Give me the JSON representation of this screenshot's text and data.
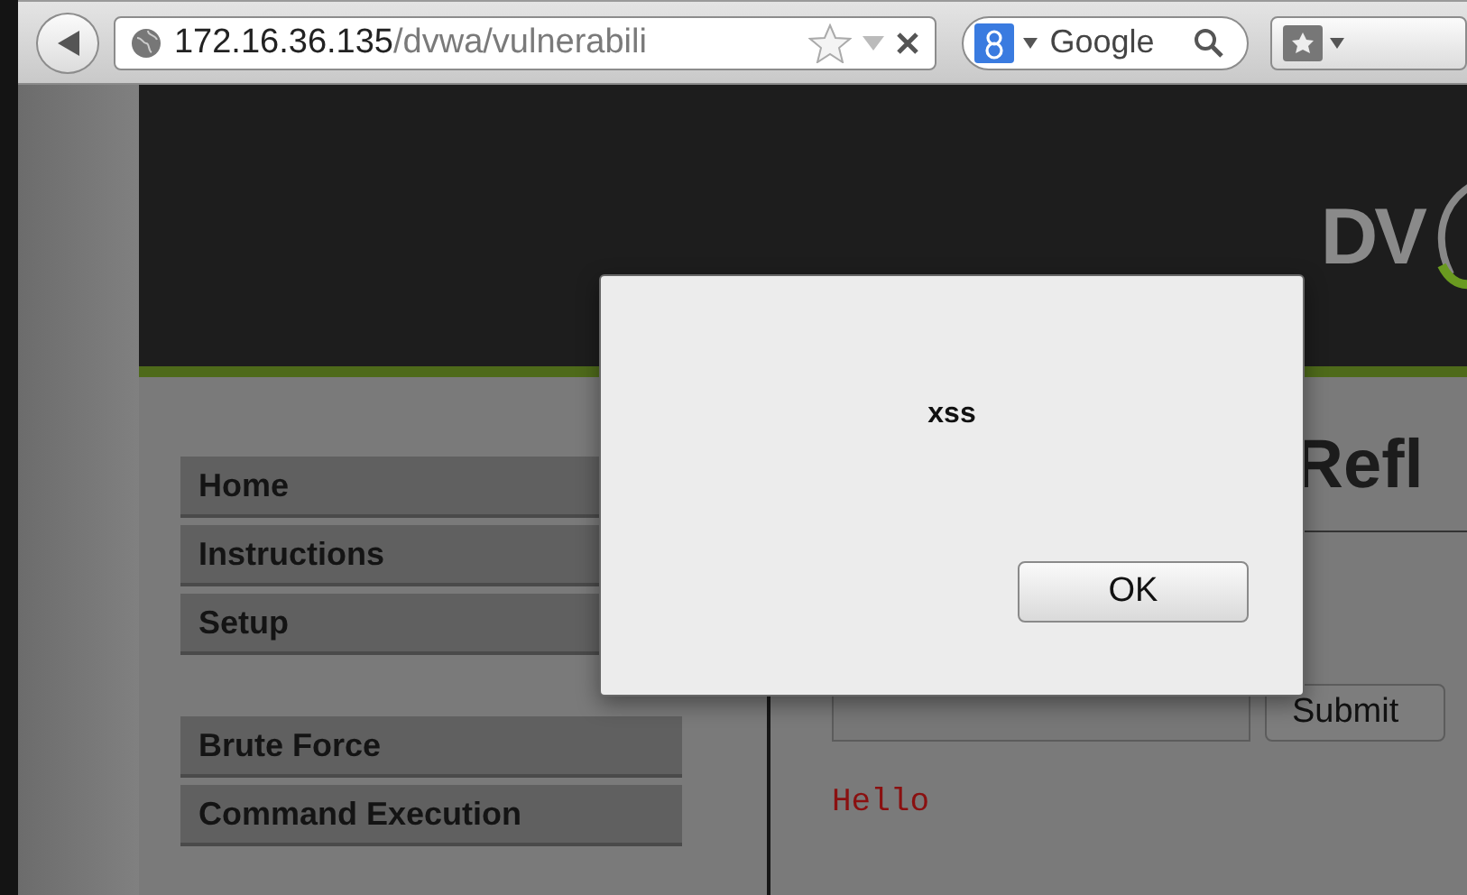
{
  "browser": {
    "url_host": "172.16.36.135",
    "url_path": "/dvwa/vulnerabili",
    "search_placeholder": "Google"
  },
  "header": {
    "logo": "DV"
  },
  "menu_groups": [
    [
      "Home",
      "Instructions",
      "Setup"
    ],
    [
      "Brute Force",
      "Command Execution"
    ]
  ],
  "main": {
    "title": "Refl",
    "submit": "Submit",
    "output": "Hello"
  },
  "dialog": {
    "message": "xss",
    "button": "OK"
  }
}
